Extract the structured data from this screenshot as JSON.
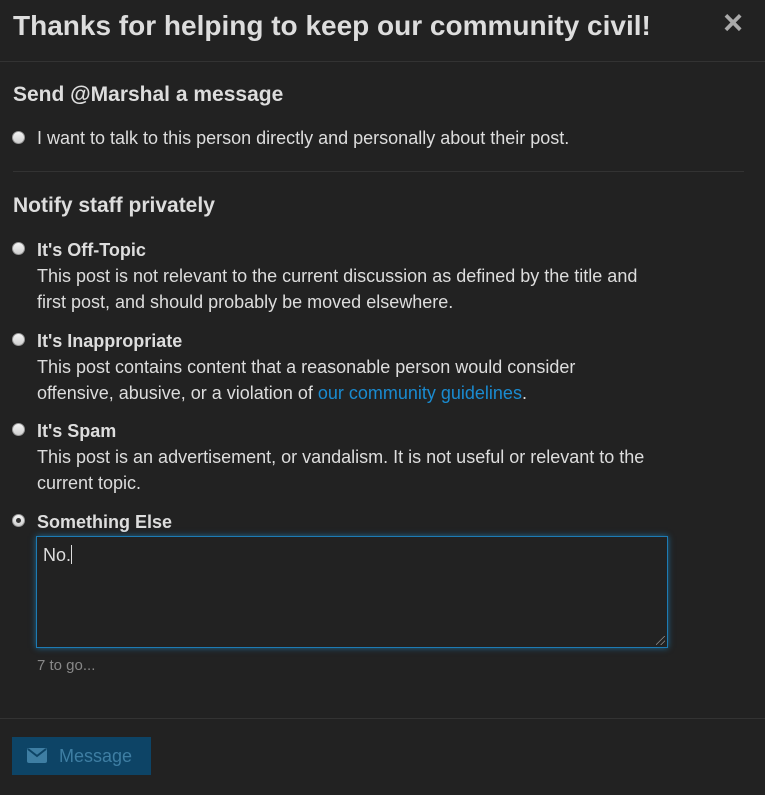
{
  "modal": {
    "title": "Thanks for helping to keep our community civil!",
    "close_glyph": "×"
  },
  "message_section": {
    "heading": "Send @Marshal a message",
    "option_text": "I want to talk to this person directly and personally about their post."
  },
  "staff_section": {
    "heading": "Notify staff privately",
    "options": [
      {
        "label": "It's Off-Topic",
        "description": "This post is not relevant to the current discussion as defined by the title and first post, and should probably be moved elsewhere."
      },
      {
        "label": "It's Inappropriate",
        "description_before": "This post contains content that a reasonable person would consider offensive, abusive, or a violation of ",
        "link_text": "our community guidelines",
        "description_after": "."
      },
      {
        "label": "It's Spam",
        "description": "This post is an advertisement, or vandalism. It is not useful or relevant to the current topic."
      },
      {
        "label": "Something Else",
        "selected": true
      }
    ]
  },
  "textarea": {
    "value": "No."
  },
  "counter": "7 to go...",
  "footer": {
    "button_label": "Message",
    "button_icon": "envelope-icon"
  },
  "colors": {
    "background": "#222222",
    "text": "#dddddd",
    "link": "#1a8bd0",
    "focus_border": "#1d7bb4",
    "button_bg": "#0d4466",
    "button_text": "#3e7ea3"
  }
}
